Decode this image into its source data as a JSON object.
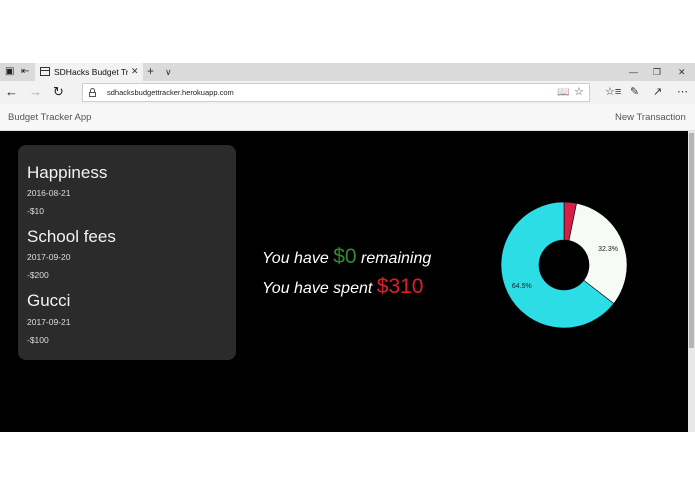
{
  "browser": {
    "tab_title": "SDHacks Budget Tracke",
    "url": "sdhacksbudgettracker.herokuapp.com"
  },
  "app": {
    "title": "Budget Tracker App",
    "new_transaction_label": "New Transaction"
  },
  "transactions": [
    {
      "name": "Happiness",
      "date": "2016-08-21",
      "amount": "-$10"
    },
    {
      "name": "School fees",
      "date": "2017-09-20",
      "amount": "-$200"
    },
    {
      "name": "Gucci",
      "date": "2017-09-21",
      "amount": "-$100"
    }
  ],
  "summary": {
    "remaining_prefix": "You have",
    "remaining_amount": "$0",
    "remaining_suffix": "remaining",
    "spent_prefix": "You have spent",
    "spent_amount": "$310"
  },
  "chart_data": {
    "type": "pie",
    "donut": true,
    "slices": [
      {
        "label": "3.2%",
        "value": 3.2,
        "color": "#d41f46"
      },
      {
        "label": "32.3%",
        "value": 32.3,
        "color": "#f7fbf6"
      },
      {
        "label": "64.5%",
        "value": 64.5,
        "color": "#2ddde6"
      }
    ]
  }
}
